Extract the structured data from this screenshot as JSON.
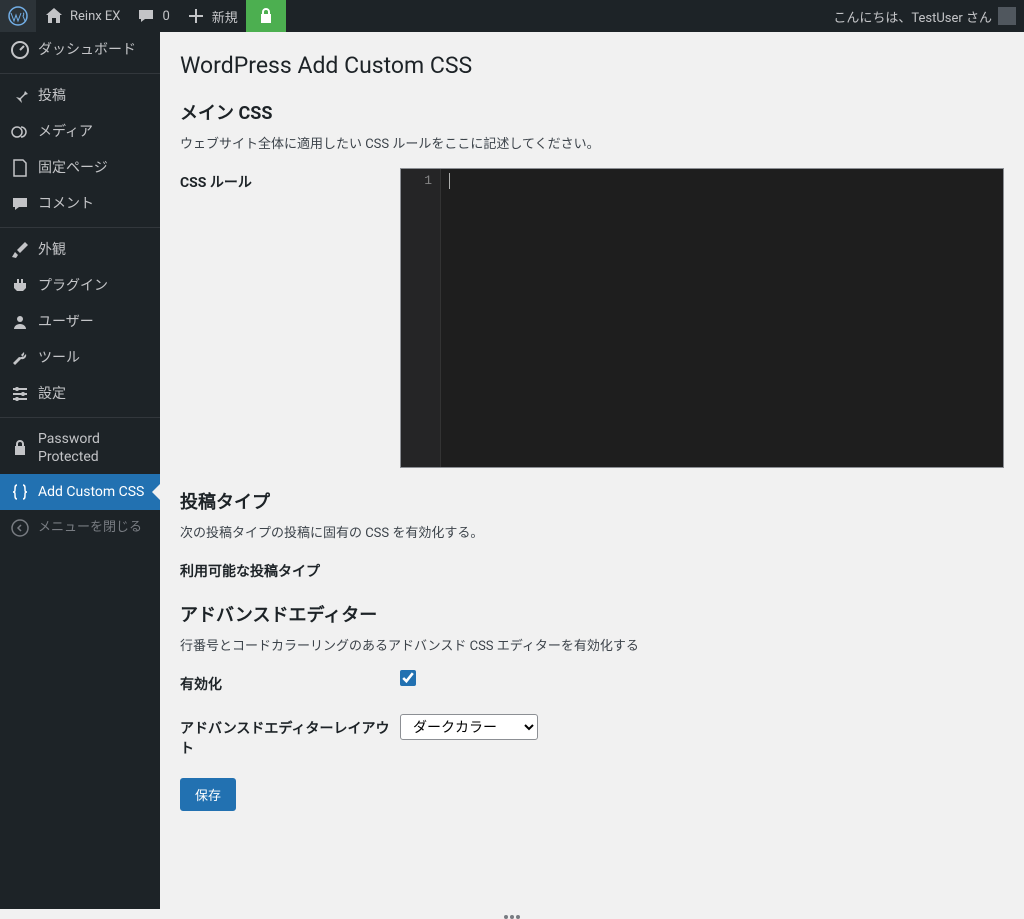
{
  "adminbar": {
    "site_name": "Reinx EX",
    "comments": "0",
    "new_label": "新規",
    "greeting": "こんにちは、TestUser さん"
  },
  "sidebar": {
    "dashboard": "ダッシュボード",
    "posts": "投稿",
    "media": "メディア",
    "pages": "固定ページ",
    "comments": "コメント",
    "appearance": "外観",
    "plugins": "プラグイン",
    "users": "ユーザー",
    "tools": "ツール",
    "settings": "設定",
    "password_protected": "Password Protected",
    "add_custom_css": "Add Custom CSS",
    "collapse": "メニューを閉じる"
  },
  "page": {
    "title": "WordPress Add Custom CSS",
    "main_css_heading": "メイン CSS",
    "main_css_desc": "ウェブサイト全体に適用したい CSS ルールをここに記述してください。",
    "css_rules_label": "CSS ルール",
    "editor_line": "1",
    "post_types_heading": "投稿タイプ",
    "post_types_desc": "次の投稿タイプの投稿に固有の CSS を有効化する。",
    "available_types_label": "利用可能な投稿タイプ",
    "advanced_heading": "アドバンスドエディター",
    "advanced_desc": "行番号とコードカラーリングのあるアドバンスド CSS エディターを有効化する",
    "enable_label": "有効化",
    "layout_label": "アドバンスドエディターレイアウト",
    "layout_value": "ダークカラー",
    "save_label": "保存"
  }
}
